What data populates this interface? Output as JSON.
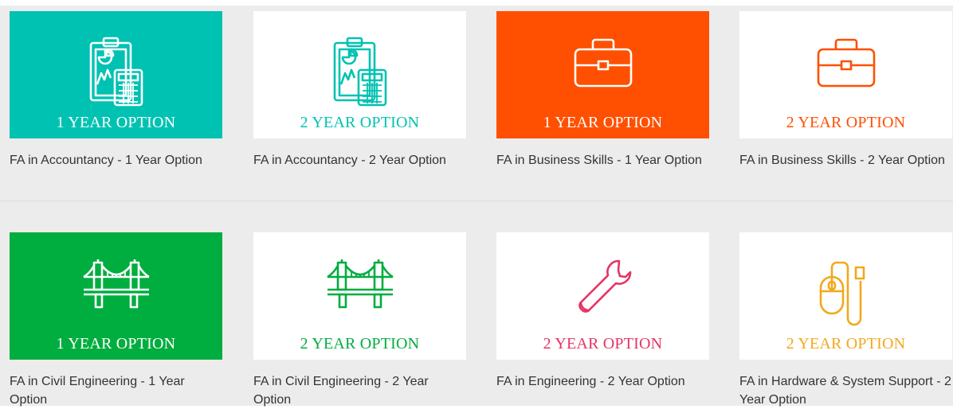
{
  "colors": {
    "teal": "#00c2b2",
    "orange": "#fe5000",
    "green": "#00ad3f",
    "pink": "#e63462",
    "amber": "#f2a81d",
    "white": "#ffffff"
  },
  "courses": [
    {
      "title": "FA in Accountancy - 1 Year Option",
      "option": "1 YEAR OPTION",
      "icon": "clipboard-calculator-icon",
      "style": "filled",
      "color": "#00c2b2"
    },
    {
      "title": "FA in Accountancy - 2 Year Option",
      "option": "2 YEAR OPTION",
      "icon": "clipboard-calculator-icon",
      "style": "outline",
      "color": "#00c2b2"
    },
    {
      "title": "FA in Business Skills - 1 Year Option",
      "option": "1 YEAR OPTION",
      "icon": "briefcase-icon",
      "style": "filled",
      "color": "#fe5000"
    },
    {
      "title": "FA in Business Skills - 2 Year Option",
      "option": "2 YEAR OPTION",
      "icon": "briefcase-icon",
      "style": "outline",
      "color": "#fe5000"
    },
    {
      "title": "FA in Civil Engineering - 1 Year Option",
      "option": "1 YEAR OPTION",
      "icon": "bridge-icon",
      "style": "filled",
      "color": "#00ad3f"
    },
    {
      "title": "FA in Civil Engineering - 2 Year Option",
      "option": "2 YEAR OPTION",
      "icon": "bridge-icon",
      "style": "outline",
      "color": "#00ad3f"
    },
    {
      "title": "FA in Engineering - 2 Year Option",
      "option": "2 YEAR OPTION",
      "icon": "wrench-icon",
      "style": "outline",
      "color": "#e63462"
    },
    {
      "title": "FA in Hardware & System Support - 2 Year Option",
      "option": "2 YEAR OPTION",
      "icon": "mouse-icon",
      "style": "outline",
      "color": "#f2a81d"
    }
  ]
}
